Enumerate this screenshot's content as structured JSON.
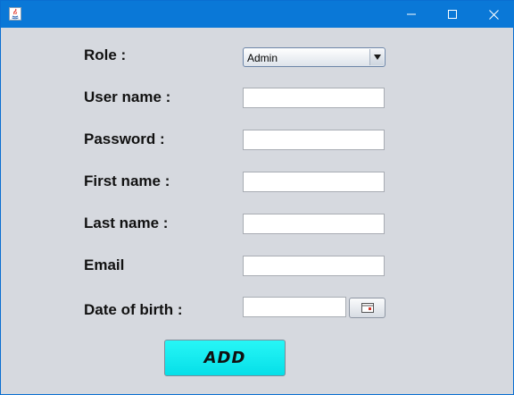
{
  "window": {
    "app_icon": "java-icon",
    "controls": {
      "minimize": "minimize-icon",
      "maximize": "maximize-icon",
      "close": "close-icon"
    }
  },
  "form": {
    "role_label": "Role :",
    "role_value": "Admin",
    "username_label": "User name :",
    "username_value": "",
    "password_label": "Password :",
    "password_value": "",
    "firstname_label": "First name :",
    "firstname_value": "",
    "lastname_label": "Last name :",
    "lastname_value": "",
    "email_label": "Email",
    "email_value": "",
    "dob_label": "Date of birth :",
    "dob_value": "",
    "calendar_icon": "calendar-icon",
    "add_label": "ADD"
  },
  "colors": {
    "titlebar": "#0a78d7",
    "background": "#d6d9df",
    "add_button": "#0ce8ef"
  }
}
